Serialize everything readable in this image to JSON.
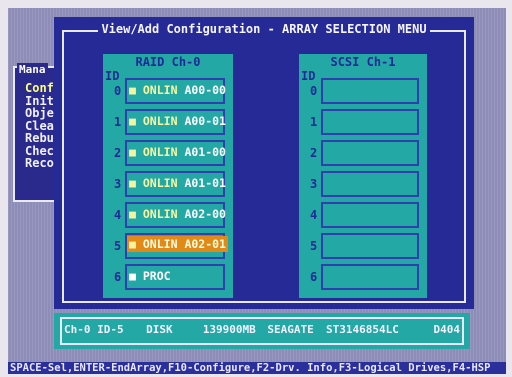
{
  "dialog": {
    "title": "View/Add Configuration - ARRAY SELECTION MENU"
  },
  "left_menu": {
    "title": "Mana",
    "items": [
      "Confi",
      "Initi",
      "Objec",
      "Clear",
      "Rebui",
      "Check",
      "Recon"
    ]
  },
  "raid_channel": {
    "title": "RAID Ch-0",
    "id_label": "ID",
    "slots": [
      {
        "id": "0",
        "marker": "■",
        "status": "ONLIN",
        "array": "A00-00"
      },
      {
        "id": "1",
        "marker": "■",
        "status": "ONLIN",
        "array": "A00-01"
      },
      {
        "id": "2",
        "marker": "■",
        "status": "ONLIN",
        "array": "A01-00"
      },
      {
        "id": "3",
        "marker": "■",
        "status": "ONLIN",
        "array": "A01-01"
      },
      {
        "id": "4",
        "marker": "■",
        "status": "ONLIN",
        "array": "A02-00"
      },
      {
        "id": "5",
        "marker": "■",
        "status": "ONLIN",
        "array": "A02-01"
      },
      {
        "id": "6",
        "marker": "■",
        "status": "PROC",
        "array": ""
      }
    ]
  },
  "scsi_channel": {
    "title": "SCSI Ch-1",
    "id_label": "ID",
    "slots": [
      "0",
      "1",
      "2",
      "3",
      "4",
      "5",
      "6"
    ]
  },
  "info_bar": {
    "channel": "Ch-0 ID-5",
    "type": "DISK",
    "size": "139900MB",
    "vendor": "SEAGATE",
    "model": "ST3146854LC",
    "revision": "D404"
  },
  "help_text": "SPACE-Sel,ENTER-EndArray,F10-Configure,F2-Drv. Info,F3-Logical Drives,F4-HSP",
  "colors": {
    "background": "#8d8db8",
    "dialog": "#262a96",
    "panel": "#23a8a6",
    "selected": "#e28a17",
    "status_text": "#fbf7a0"
  }
}
